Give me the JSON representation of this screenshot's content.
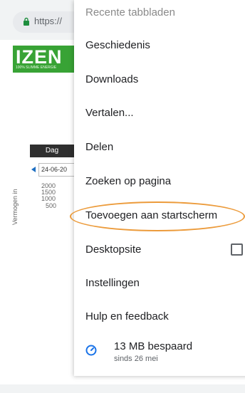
{
  "browser": {
    "url": "https://",
    "icons": {
      "lock": "lock-icon"
    }
  },
  "background_page": {
    "logo_text": "IZEN",
    "logo_subtext": "100% SLIMME ENERGIE",
    "tab_label": "Dag",
    "date_value": "24-06-20",
    "y_axis_label": "Vermogen in",
    "y_ticks": [
      "2000",
      "1500",
      "1000",
      "500"
    ],
    "colors": {
      "logo_green": "#38a335",
      "accent_blue": "#1e6fc2"
    }
  },
  "menu": {
    "items": [
      {
        "label": "Recente tabbladen"
      },
      {
        "label": "Geschiedenis"
      },
      {
        "label": "Downloads"
      },
      {
        "label": "Vertalen..."
      },
      {
        "label": "Delen"
      },
      {
        "label": "Zoeken op pagina"
      },
      {
        "label": "Toevoegen aan startscherm",
        "highlighted": true
      },
      {
        "label": "Desktopsite",
        "checkbox_checked": false
      },
      {
        "label": "Instellingen"
      },
      {
        "label": "Hulp en feedback"
      }
    ],
    "savings": {
      "title": "13 MB bespaard",
      "subtitle": "sinds 26 mei",
      "icon": "speedometer-icon"
    },
    "highlight_color": "#ec9b3b"
  }
}
